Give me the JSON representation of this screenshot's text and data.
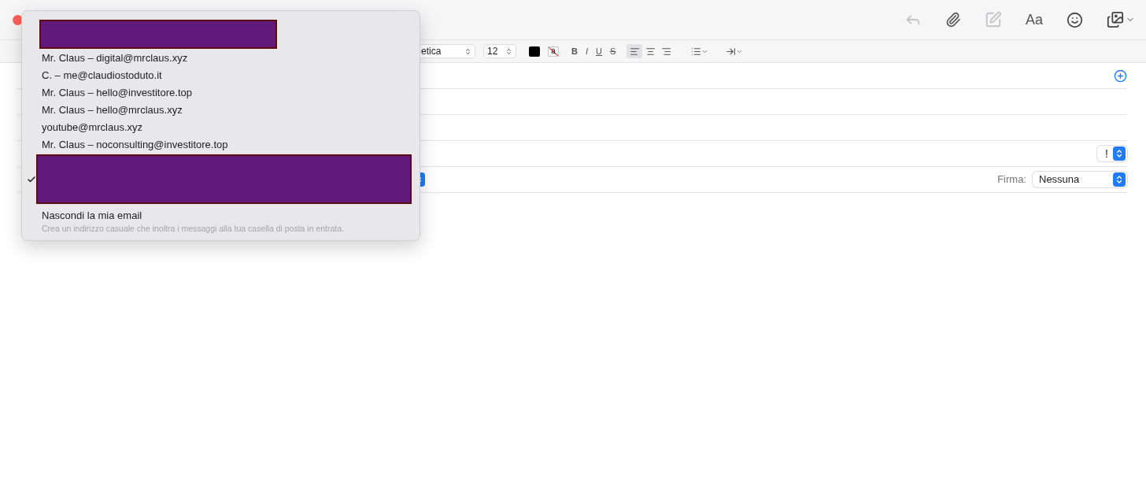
{
  "toolbar": {
    "reply_disabled": true,
    "markup_disabled": true,
    "font_button": "Aa"
  },
  "format_bar": {
    "highlight_glyph": "a",
    "font": "etica",
    "size": "12",
    "bold": "B",
    "italic": "I",
    "underline": "U",
    "strike": "S",
    "alignments": [
      {
        "kind": "left",
        "selected": true
      },
      {
        "kind": "center",
        "selected": false
      },
      {
        "kind": "right",
        "selected": false
      }
    ]
  },
  "header_rows": [
    {
      "kind": "add"
    },
    {
      "kind": "plain"
    },
    {
      "kind": "plain"
    },
    {
      "kind": "priority",
      "priority": "!"
    },
    {
      "kind": "from",
      "signature_label": "Firma:",
      "signature": "Nessuna"
    }
  ],
  "menu": {
    "items": [
      {
        "kind": "redacted",
        "selected": false
      },
      {
        "kind": "address",
        "text": "Mr. Claus – digital@mrclaus.xyz",
        "selected": false
      },
      {
        "kind": "address",
        "text": "C. – me@claudiostoduto.it",
        "selected": false
      },
      {
        "kind": "address",
        "text": "Mr. Claus – hello@investitore.top",
        "selected": false
      },
      {
        "kind": "address",
        "text": "Mr. Claus – hello@mrclaus.xyz",
        "selected": false
      },
      {
        "kind": "address",
        "text": "youtube@mrclaus.xyz",
        "selected": false
      },
      {
        "kind": "address",
        "text": "Mr. Claus – noconsulting@investitore.top",
        "selected": false
      },
      {
        "kind": "redacted",
        "selected": true
      },
      {
        "kind": "option",
        "text": "Nascondi la mia email",
        "description": "Crea un indirizzo casuale che inoltra i messaggi alla tua casella di posta in entrata.",
        "selected": false
      }
    ]
  }
}
